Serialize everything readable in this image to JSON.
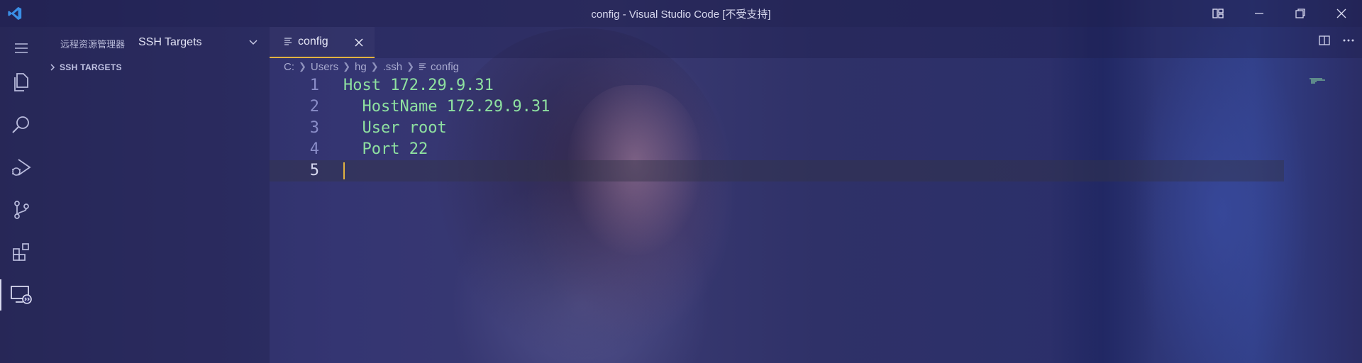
{
  "window": {
    "title": "config - Visual Studio Code [不受支持]"
  },
  "sidebar": {
    "view_title": "远程资源管理器",
    "target_select": "SSH Targets",
    "section_label": "SSH TARGETS"
  },
  "tabs": [
    {
      "label": "config",
      "active": true
    }
  ],
  "breadcrumb": [
    "C:",
    "Users",
    "hg",
    ".ssh",
    "config"
  ],
  "editor": {
    "lines": [
      {
        "num": "1",
        "text": "Host 172.29.9.31"
      },
      {
        "num": "2",
        "text": "  HostName 172.29.9.31"
      },
      {
        "num": "3",
        "text": "  User root"
      },
      {
        "num": "4",
        "text": "  Port 22"
      },
      {
        "num": "5",
        "text": ""
      }
    ],
    "current_line": 5
  },
  "colors": {
    "accent": "#e2b340",
    "code_text": "#8ee0a0",
    "line_numbers": "#8a8dc8"
  },
  "icons": {
    "app": "vscode-logo-icon",
    "activity": [
      "menu-icon",
      "explorer-icon",
      "search-icon",
      "run-debug-icon",
      "source-control-icon",
      "extensions-icon",
      "remote-explorer-icon"
    ]
  }
}
